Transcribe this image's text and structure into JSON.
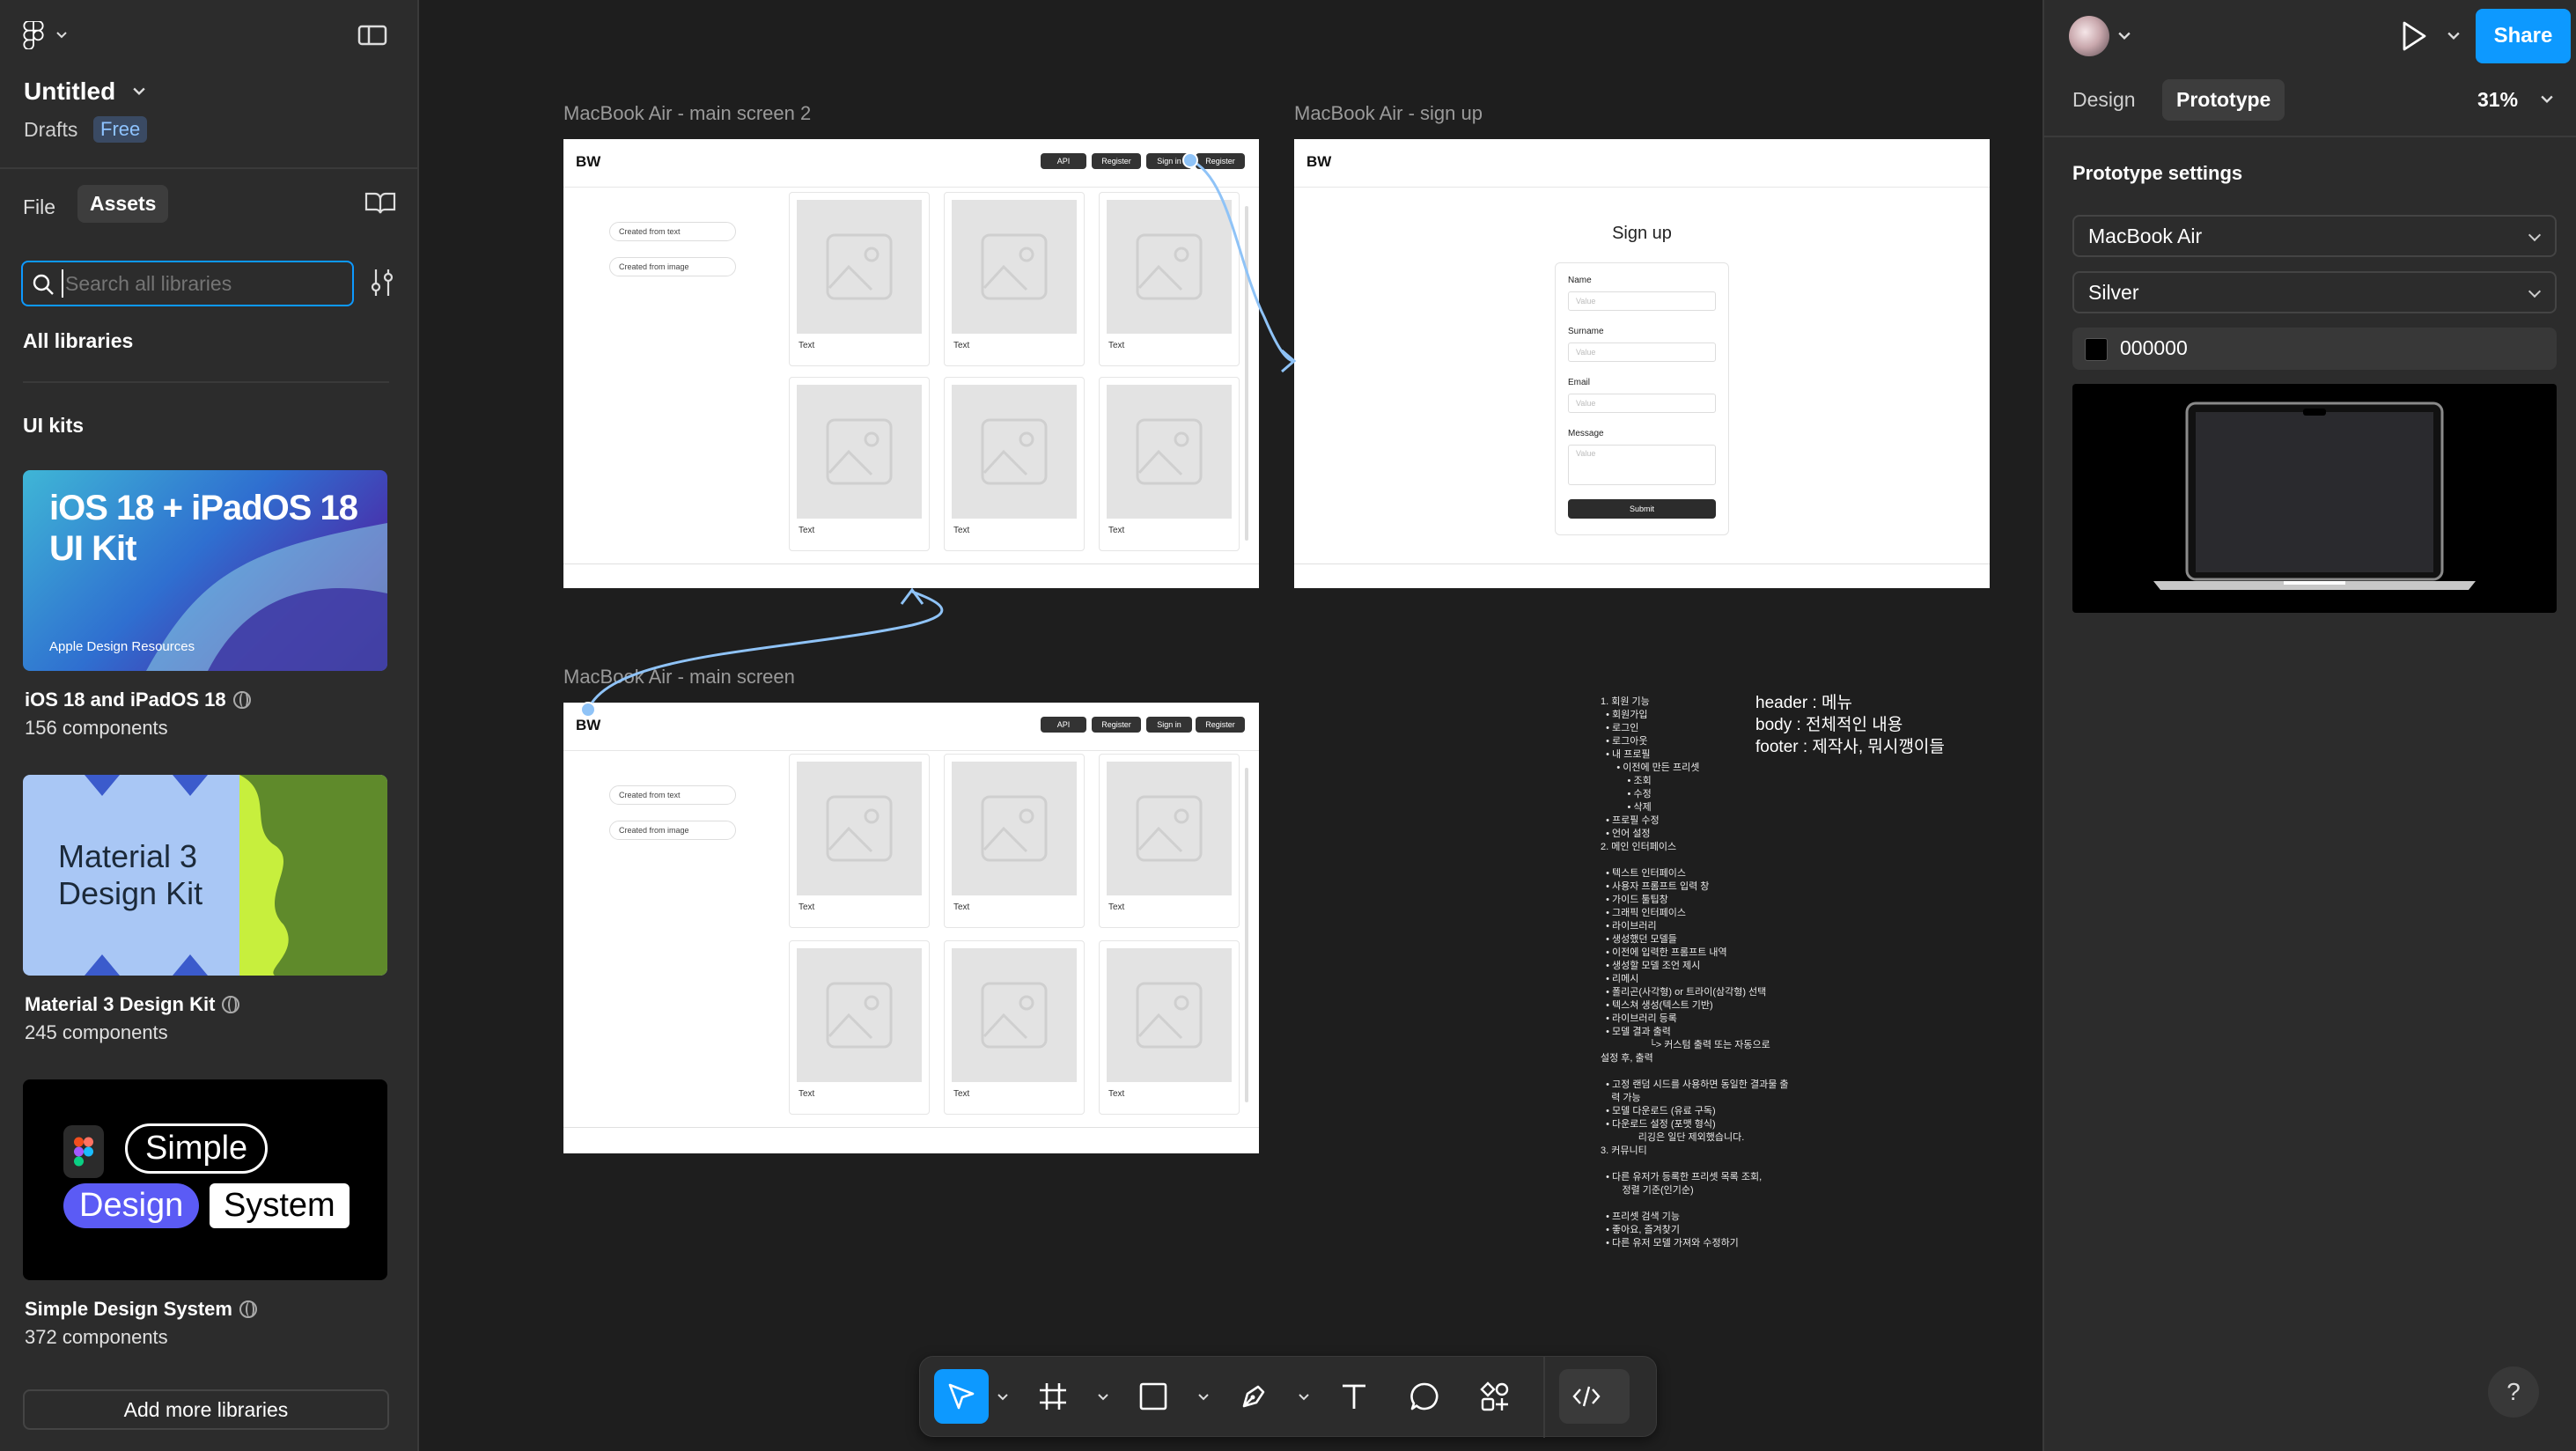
{
  "file": {
    "title": "Untitled",
    "location": "Drafts",
    "plan_badge": "Free"
  },
  "left_tabs": {
    "file": "File",
    "assets": "Assets"
  },
  "search": {
    "placeholder": "Search all libraries",
    "value": ""
  },
  "libraries": {
    "all_label": "All libraries",
    "section_label": "UI kits",
    "kits": [
      {
        "name": "iOS 18 and iPadOS 18",
        "count": "156 components",
        "thumb_title": "iOS 18 + iPadOS 18\nUI Kit",
        "thumb_title_line1": "iOS 18 + iPadOS 18",
        "thumb_title_line2": "UI Kit",
        "thumb_sub": "Apple Design Resources"
      },
      {
        "name": "Material 3 Design Kit",
        "count": "245 components",
        "thumb_title_line1": "Material 3",
        "thumb_title_line2": "Design Kit"
      },
      {
        "name": "Simple Design System",
        "count": "372 components",
        "thumb_word1": "Simple",
        "thumb_word2": "Design",
        "thumb_word3": "System"
      }
    ],
    "add_more": "Add more libraries"
  },
  "right_panel": {
    "tabs": {
      "design": "Design",
      "prototype": "Prototype"
    },
    "zoom": "31%",
    "share": "Share",
    "section_title": "Prototype settings",
    "device": "MacBook Air",
    "model": "Silver",
    "background_color": "000000"
  },
  "canvas": {
    "frames": [
      {
        "label": "MacBook Air - main screen 2"
      },
      {
        "label": "MacBook Air - sign up"
      },
      {
        "label": "MacBook Air - main screen"
      }
    ],
    "frame_ui": {
      "logo": "BW",
      "nav": [
        "API",
        "Register",
        "Sign in",
        "Register"
      ],
      "pills": [
        "Created from text",
        "Created from image"
      ],
      "card_text": "Text"
    },
    "signup": {
      "title": "Sign up",
      "fields": [
        "Name",
        "Surname",
        "Email",
        "Message"
      ],
      "placeholder": "Value",
      "submit": "Submit"
    },
    "note_right": [
      "header : 메뉴",
      "body : 전체적인 내용",
      "footer : 제작사, 뭐시깽이들"
    ],
    "note_list": "1. 회원 기능\n  • 회원가입\n  • 로그인\n  • 로그아웃\n  • 내 프로필\n      • 이전에 만든 프리셋\n          • 조회\n          • 수정\n          • 삭제\n  • 프로필 수정\n  • 언어 설정\n2. 메인 인터페이스\n\n  • 텍스트 인터페이스\n  • 사용자 프롬프트 입력 창\n  • 가이드 툴팁창\n  • 그래픽 인터페이스\n  • 라이브러리\n  • 생성했던 모델들\n  • 이전에 입력한 프롬프트 내역\n  • 생성할 모델 조언 제시\n  • 리메시\n  • 폴리곤(사각형) or 트라이(삼각형) 선택\n  • 텍스쳐 생성(텍스트 기반)\n  • 라이브러리 등록\n  • 모델 결과 출력\n                  └> 커스텀 출력 또는 자동으로\n설정 후, 출력\n\n  • 고정 랜덤 시드를 사용하면 동일한 결과물 출\n    력 가능\n  • 모델 다운로드 (유료 구독)\n  • 다운로드 설정 (포맷 형식)\n              리깅은 일단 제외했습니다.\n3. 커뮤니티\n\n  • 다른 유저가 등록한 프리셋 목록 조회,\n        정렬 기준(인기순)\n\n  • 프리셋 검색 기능\n  • 좋아요, 즐겨찾기\n  • 다른 유저 모델 가져와 수정하기"
  },
  "colors": {
    "accent": "#0d99ff",
    "canvas": "#1e1e1e",
    "panel": "#2c2c2c",
    "connector": "#8fc3f7"
  },
  "help": "?"
}
